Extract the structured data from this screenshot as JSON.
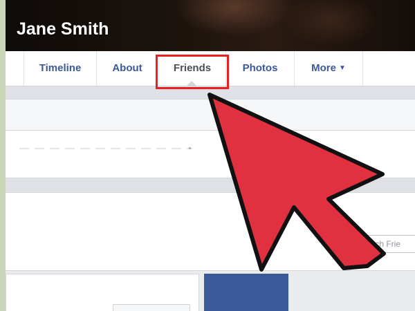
{
  "profile": {
    "name": "Jane Smith"
  },
  "tabs": [
    {
      "label": "Timeline"
    },
    {
      "label": "About"
    },
    {
      "label": "Friends",
      "active": true,
      "highlighted": true
    },
    {
      "label": "Photos"
    },
    {
      "label": "More",
      "icon": "caret-down-icon"
    }
  ],
  "friends_search": {
    "visible_text": "earch Frie"
  },
  "annotation": {
    "arrow_color": "#e1303f",
    "highlight_color": "#e8211e",
    "icon": "pointer-arrow-icon"
  },
  "colors": {
    "link": "#3b5998",
    "background": "#e9ebee",
    "border": "#c9d6b8"
  }
}
